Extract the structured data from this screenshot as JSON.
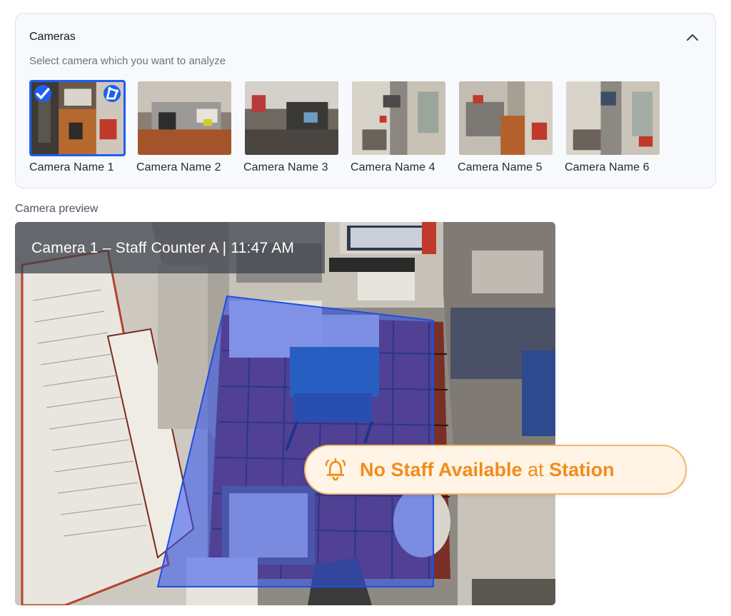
{
  "cameras": {
    "title": "Cameras",
    "subtitle": "Select camera which you want to analyze",
    "items": [
      {
        "label": "Camera Name 1",
        "selected": true
      },
      {
        "label": "Camera Name 2",
        "selected": false
      },
      {
        "label": "Camera Name 3",
        "selected": false
      },
      {
        "label": "Camera Name 4",
        "selected": false
      },
      {
        "label": "Camera Name 5",
        "selected": false
      },
      {
        "label": "Camera Name 6",
        "selected": false
      }
    ]
  },
  "preview": {
    "label": "Camera preview",
    "title": "Camera 1 – Staff Counter A | 11:47 AM"
  },
  "alert": {
    "part1": "No Staff Available",
    "part2": " at ",
    "part3": "Station",
    "icon": "bell-icon"
  },
  "colors": {
    "accent": "#1d5ff0",
    "alert_text": "#f28c1b",
    "alert_bg": "#fff4e6",
    "alert_border": "#f5b468",
    "zone_fill": "#3355ee"
  }
}
